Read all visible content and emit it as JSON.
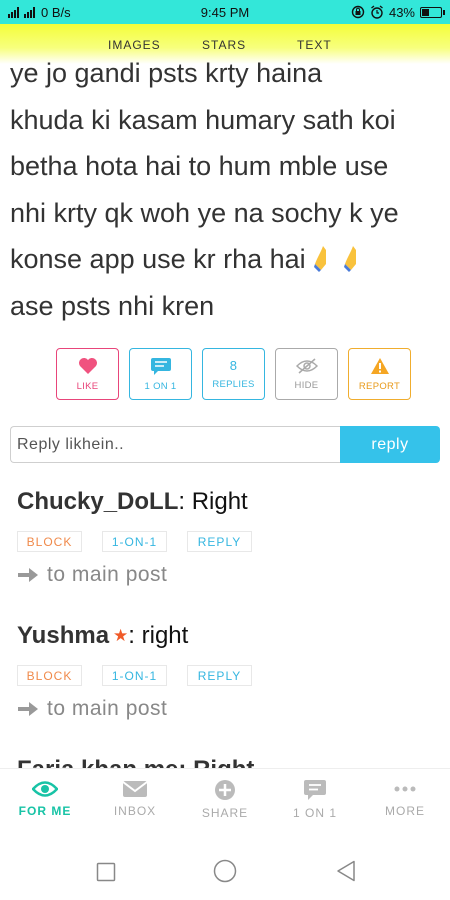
{
  "status_bar": {
    "network_speed": "0 B/s",
    "time": "9:45 PM",
    "battery": "43%",
    "battery_level": 0.43
  },
  "top_nav": {
    "tabs": [
      "IMAGES",
      "STARS",
      "TEXT"
    ]
  },
  "post": {
    "lines": [
      "ye jo gandi psts krty haina",
      "khuda ki kasam humary sath koi",
      "betha hota hai to hum mble use",
      "nhi krty qk woh ye na sochy k ye",
      "konse app use kr rha hai",
      "ase psts nhi kren"
    ],
    "emoji": "folded-hands-icon"
  },
  "post_actions": {
    "like": "LIKE",
    "one_on_one": "1 ON 1",
    "reply_count": "8",
    "replies": "REPLIES",
    "hide": "HIDE",
    "report": "REPORT"
  },
  "reply_box": {
    "placeholder": "Reply likhein..",
    "button": "reply"
  },
  "comments": [
    {
      "user": "Chucky_DoLL",
      "text": ": Right",
      "starred": false
    },
    {
      "user": "Yushma",
      "text": ": right",
      "starred": true
    }
  ],
  "comment_actions": {
    "block": "BLOCK",
    "one_on_one": "1-ON-1",
    "reply": "REPLY",
    "to_main": "to main post"
  },
  "partial_comment": "Faria khan me: Right",
  "bottom_nav": {
    "items": [
      {
        "label": "FOR ME",
        "icon": "eye-icon",
        "active": true
      },
      {
        "label": "INBOX",
        "icon": "envelope-icon",
        "active": false
      },
      {
        "label": "SHARE",
        "icon": "plus-circle-icon",
        "active": false
      },
      {
        "label": "1 ON 1",
        "icon": "chat-bubble-icon",
        "active": false
      },
      {
        "label": "MORE",
        "icon": "more-dots-icon",
        "active": false
      }
    ]
  },
  "colors": {
    "status_bar": "#33e7d9",
    "top_nav": "#f4fe3a",
    "like": "#e8457a",
    "accent_blue": "#35c2ea",
    "report": "#f0ad2e",
    "active_nav": "#18c3a6"
  }
}
